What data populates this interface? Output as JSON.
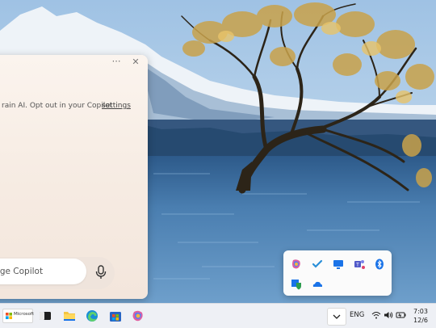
{
  "copilot": {
    "more_icon": "more-horizontal-icon",
    "close_icon": "close-icon",
    "notice_text": "rain AI. Opt out in your Copilot",
    "notice_link": "settings",
    "message_placeholder": "essage Copilot",
    "mic_icon": "microphone-icon"
  },
  "tray_flyout": {
    "icons": [
      "copilot-icon",
      "checkmark-icon",
      "screen-icon",
      "teams-icon",
      "bluetooth-icon",
      "security-icon",
      "onedrive-icon"
    ]
  },
  "taskbar": {
    "microsoft_label": "Microsoft",
    "apps": [
      "microsoft-store-widget",
      "terminal-icon",
      "file-explorer-icon",
      "edge-icon",
      "store-icon",
      "copilot-icon"
    ],
    "language": "ENG",
    "time": "7:03",
    "date": "12/6"
  },
  "colors": {
    "taskbar": "#eef0f5",
    "window_bg": "#f8efe7",
    "accent_blue": "#1a73e8"
  }
}
